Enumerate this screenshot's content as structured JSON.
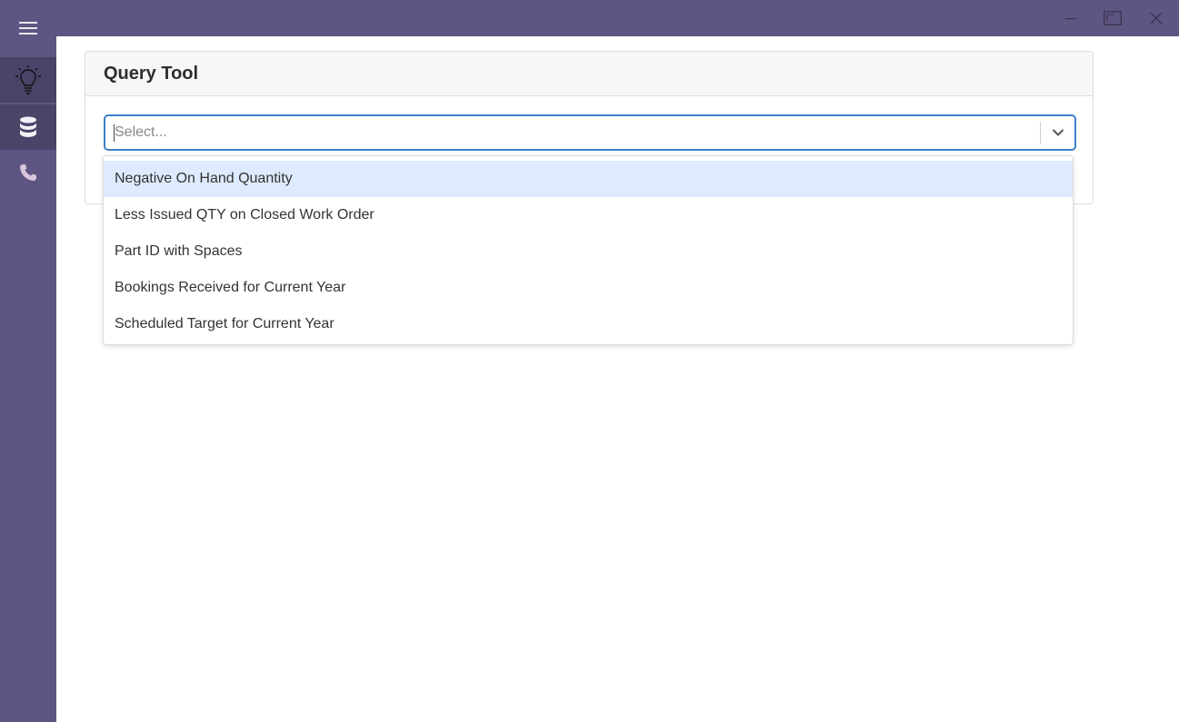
{
  "window": {
    "controls": [
      "minimize-icon",
      "maximize-icon",
      "close-icon"
    ]
  },
  "sidebar": {
    "menu_icon": "hamburger-icon",
    "items": [
      {
        "icon": "lightbulb-icon"
      },
      {
        "icon": "database-icon"
      },
      {
        "icon": "phone-icon"
      }
    ]
  },
  "card": {
    "title": "Query Tool"
  },
  "select": {
    "placeholder": "Select...",
    "options": [
      "Negative On Hand Quantity",
      "Less Issued QTY on Closed Work Order",
      "Part ID with Spaces",
      "Bookings Received for Current Year",
      "Scheduled Target for Current Year"
    ]
  },
  "colors": {
    "sidebar_bg": "#5f5582",
    "sidebar_active": "#4b4368",
    "focus_border": "#3d80c8",
    "option_highlight": "#deebff"
  }
}
